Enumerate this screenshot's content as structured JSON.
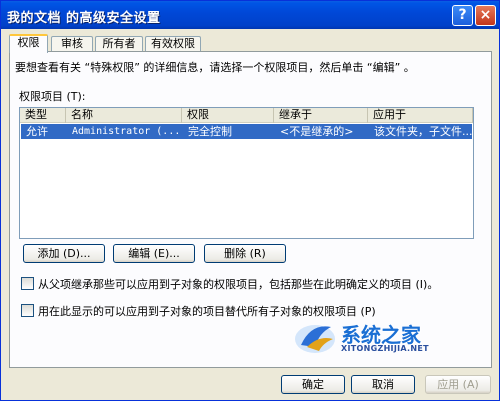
{
  "window": {
    "title": "我的文档 的高级安全设置",
    "help_glyph": "?",
    "close_glyph": "×"
  },
  "tabs": [
    {
      "label": "权限"
    },
    {
      "label": "审核"
    },
    {
      "label": "所有者"
    },
    {
      "label": "有效权限"
    }
  ],
  "permissions": {
    "description": "要想查看有关 “特殊权限” 的详细信息，请选择一个权限项目，然后单击 “编辑” 。",
    "list_label": "权限项目 (T):",
    "columns": [
      "类型",
      "名称",
      "权限",
      "继承于",
      "应用于"
    ],
    "rows": [
      {
        "type": "允许",
        "name": "Administrator (...",
        "permission": "完全控制",
        "inherited": "<不是继承的>",
        "applies": "该文件夹，子文件..."
      }
    ]
  },
  "buttons": {
    "add": "添加 (D)...",
    "edit": "编辑 (E)...",
    "remove": "删除 (R)",
    "ok": "确定",
    "cancel": "取消",
    "apply": "应用 (A)"
  },
  "options": {
    "inherit": "从父项继承那些可以应用到子对象的权限项目，包括那些在此明确定义的项目 (I)。",
    "replace": "用在此显示的可以应用到子对象的项目替代所有子对象的权限项目 (P)"
  },
  "watermark": {
    "text": "系统之家",
    "sub": "XITONGZHIJIA.NET"
  }
}
